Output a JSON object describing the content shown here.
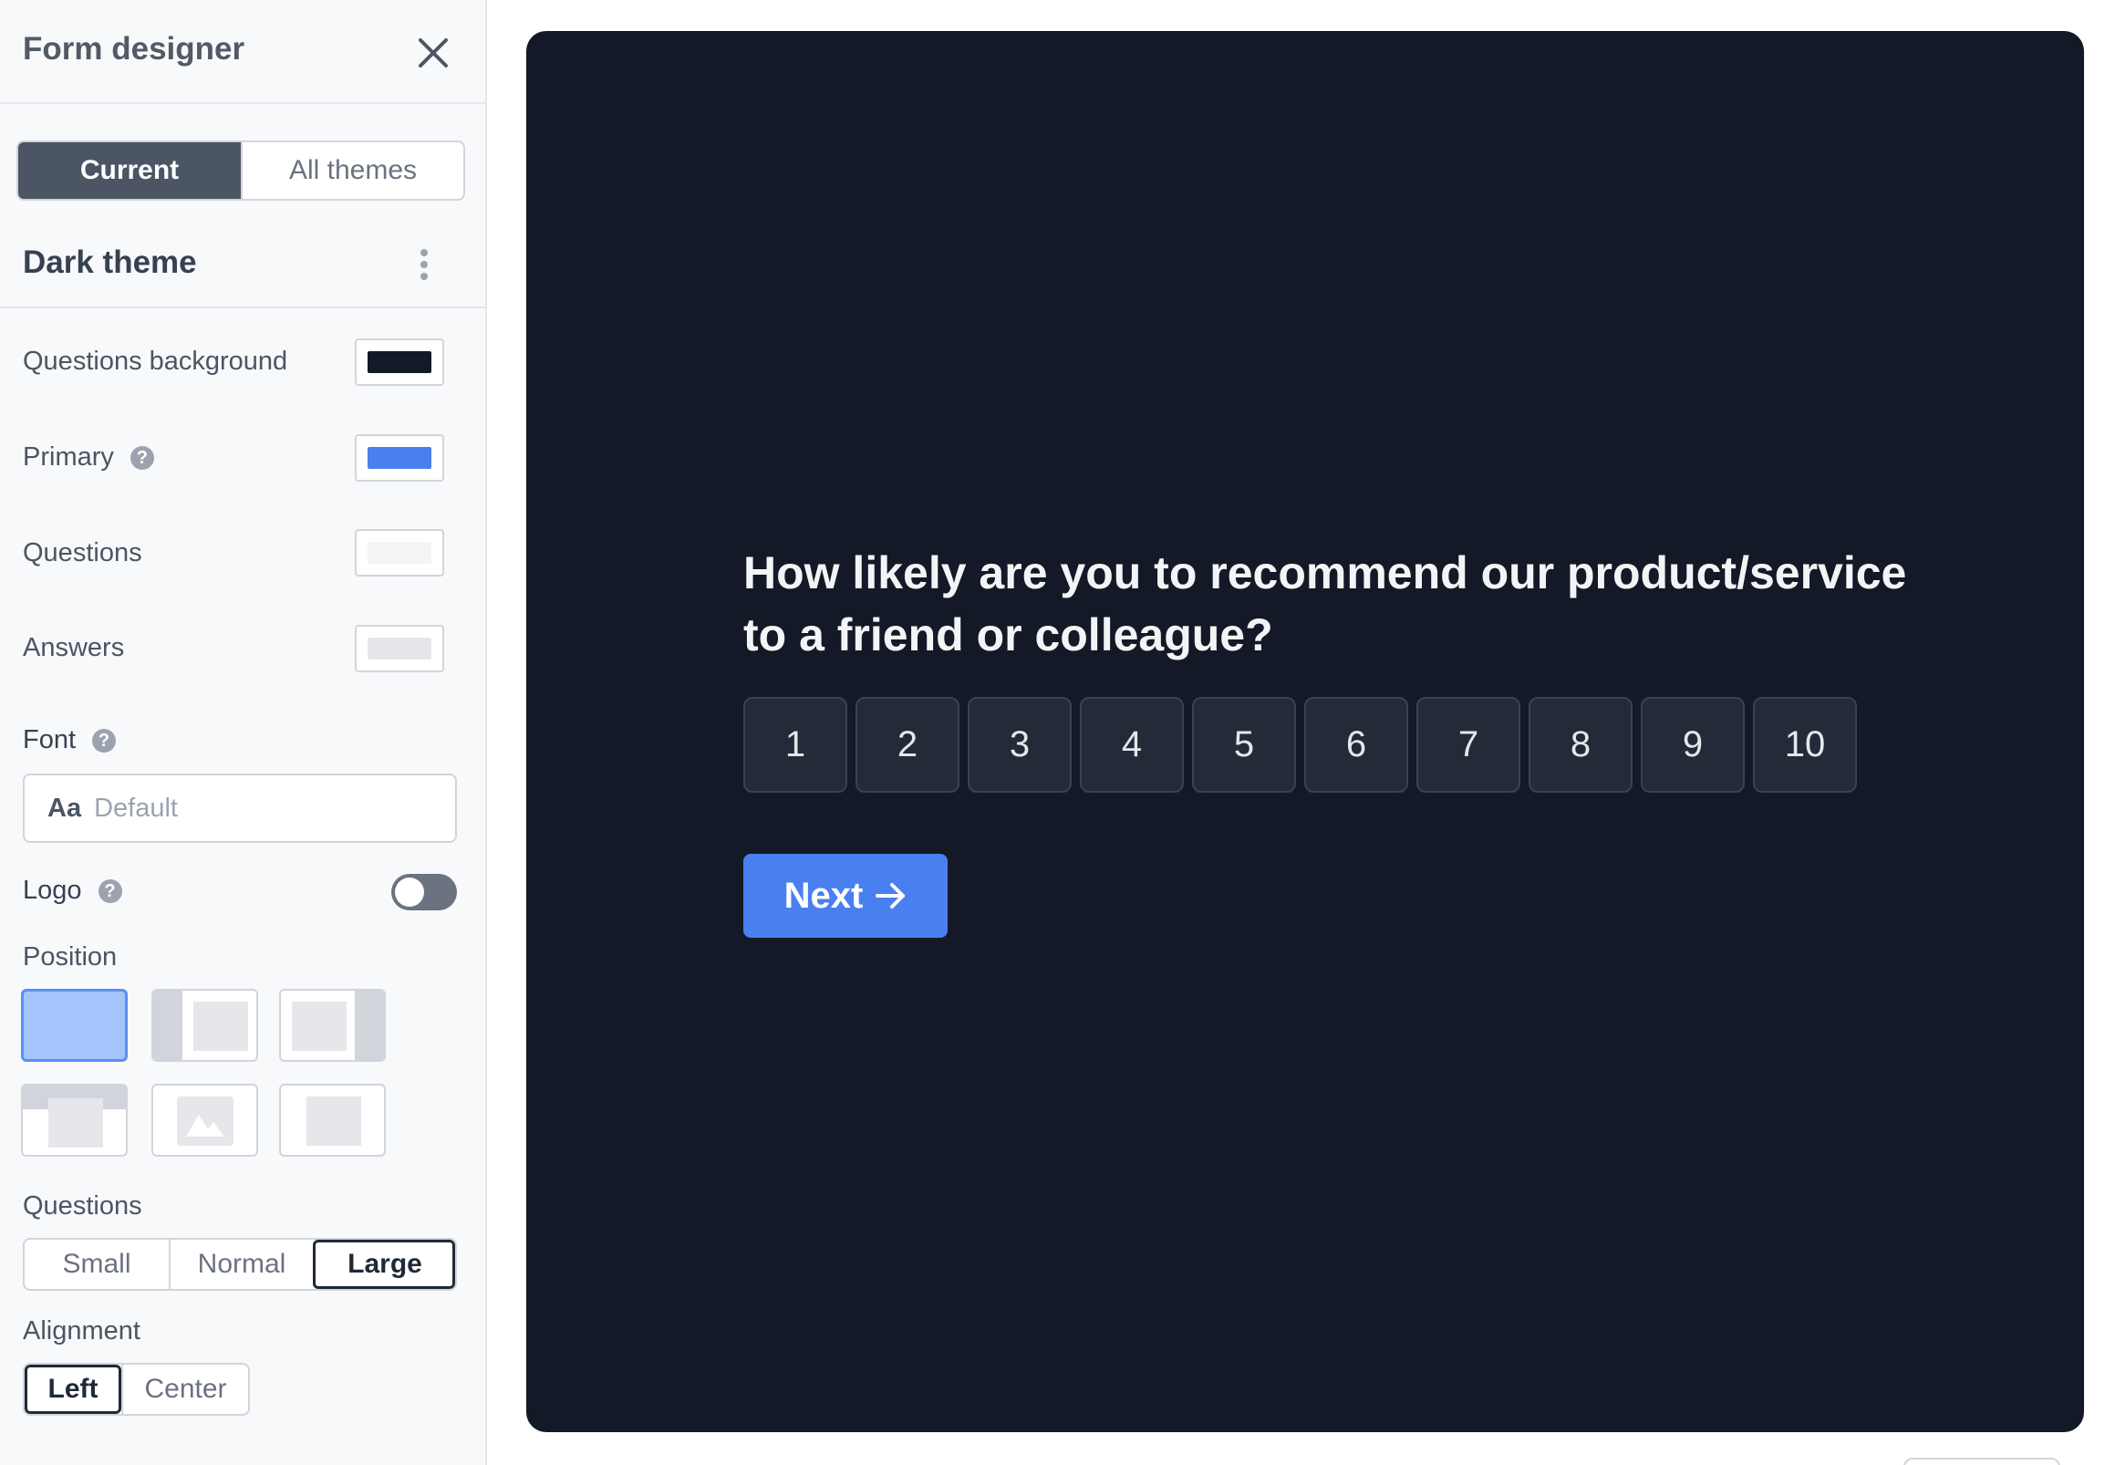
{
  "sidebar": {
    "title": "Form designer",
    "theme_tabs": [
      "Current",
      "All themes"
    ],
    "theme_name": "Dark theme",
    "colors": [
      {
        "label": "Questions background",
        "value": "#141927"
      },
      {
        "label": "Primary",
        "value": "#4a7ff0",
        "help": "?"
      },
      {
        "label": "Questions",
        "value": "#f3f4f6"
      },
      {
        "label": "Answers",
        "value": "#e5e7eb"
      }
    ],
    "font": {
      "label": "Font",
      "help": "?",
      "icon_text": "Aa",
      "value": "Default"
    },
    "logo": {
      "label": "Logo",
      "help": "?",
      "enabled": false
    },
    "position": {
      "label": "Position",
      "selected_index": 0
    },
    "questions_size": {
      "label": "Questions",
      "options": [
        "Small",
        "Normal",
        "Large"
      ],
      "selected": "Large"
    },
    "alignment": {
      "label": "Alignment",
      "options": [
        "Left",
        "Center"
      ],
      "selected": "Left"
    }
  },
  "preview": {
    "question_line1": "How likely are you to recommend our product/service",
    "question_line2": "to a friend or colleague?",
    "scale": [
      "1",
      "2",
      "3",
      "4",
      "5",
      "6",
      "7",
      "8",
      "9",
      "10"
    ],
    "next_label": "Next",
    "next_icon": "arrow-right-icon"
  }
}
